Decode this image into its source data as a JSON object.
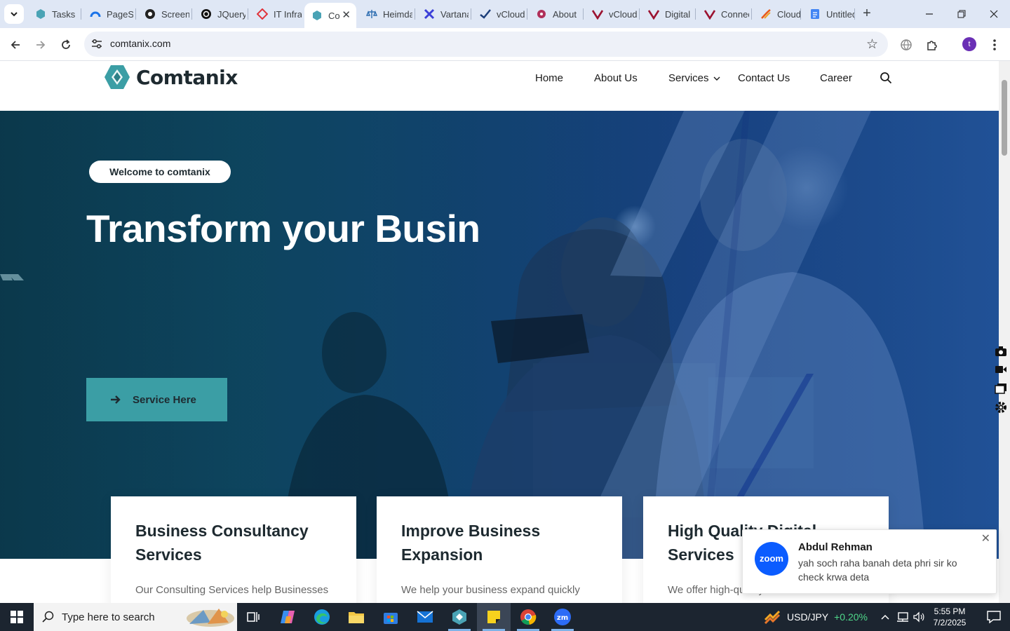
{
  "browser": {
    "tabs": [
      {
        "label": "Tasks",
        "icon": "hex-icon"
      },
      {
        "label": "PageSpeed",
        "icon": "gauge-icon"
      },
      {
        "label": "Screenshot",
        "icon": "camera-icon"
      },
      {
        "label": "JQuery",
        "icon": "openai-icon"
      },
      {
        "label": "IT Infra",
        "icon": "diamond-icon"
      },
      {
        "label": "Comtanix",
        "icon": "hex-icon"
      },
      {
        "label": "Heimdal",
        "icon": "scale-icon"
      },
      {
        "label": "Vartana",
        "icon": "x-icon"
      },
      {
        "label": "vCloud",
        "icon": "check-icon"
      },
      {
        "label": "About",
        "icon": "blossom-icon"
      },
      {
        "label": "vCloud",
        "icon": "v-icon"
      },
      {
        "label": "Digital",
        "icon": "v-icon"
      },
      {
        "label": "Connect",
        "icon": "v-icon"
      },
      {
        "label": "Cloud",
        "icon": "swoosh-icon"
      },
      {
        "label": "Untitled",
        "icon": "doc-icon"
      }
    ],
    "active_tab_label": "Co",
    "url": "comtanix.com",
    "profile_initial": "t",
    "accent": "#dfe7f5"
  },
  "site": {
    "brand": "Comtanix",
    "nav": [
      "Home",
      "About Us",
      "Services",
      "Contact Us",
      "Career"
    ],
    "hero": {
      "badge": "Welcome to comtanix",
      "title": "Transform your Busin",
      "button": "Service Here"
    },
    "cards": [
      {
        "title": "Business Consultancy Services",
        "desc": "Our Consulting Services help Businesses"
      },
      {
        "title": "Improve Business Expansion",
        "desc": "We help your business expand quickly"
      },
      {
        "title": "High Quality Digital Services",
        "desc": "We offer high-quality services that"
      }
    ],
    "colors": {
      "brand_teal": "#3b9ea5",
      "dark_text": "#1e2a30"
    }
  },
  "toast": {
    "app": "zoom",
    "sender": "Abdul Rehman",
    "message": "yah soch raha banah deta phri sir ko check krwa deta"
  },
  "taskbar": {
    "search_placeholder": "Type here to search",
    "ticker_label": "USD/JPY",
    "ticker_value": "+0.20%",
    "time": "5:55 PM",
    "date": "7/2/2025"
  }
}
